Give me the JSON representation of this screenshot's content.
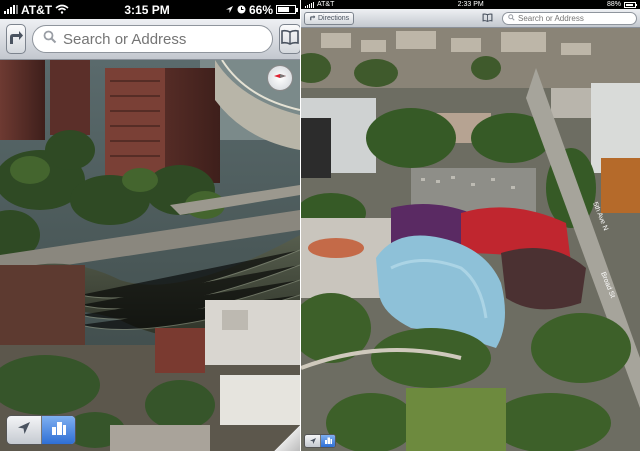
{
  "left": {
    "status": {
      "carrier": "AT&T",
      "time": "3:15 PM",
      "battery": "66%"
    },
    "search": {
      "placeholder": "Search or Address"
    },
    "toolbar": {
      "directions_icon": "directions-arrow-icon",
      "bookmarks_icon": "bookmarks-book-icon"
    },
    "controls": {
      "location_icon": "location-arrow-icon",
      "view_3d_icon": "3d-buildings-icon",
      "compass_icon": "compass-icon"
    }
  },
  "right": {
    "status": {
      "carrier": "AT&T",
      "time": "2:33 PM",
      "battery": "88%"
    },
    "toolbar": {
      "directions_label": "Directions",
      "bookmarks_icon": "bookmarks-book-icon"
    },
    "search": {
      "placeholder": "Search or Address"
    },
    "map": {
      "street_label_1": "5th Ave N",
      "street_label_2": "Broad St"
    },
    "controls": {
      "location_icon": "location-arrow-icon",
      "view_3d_icon": "3d-buildings-icon"
    }
  },
  "colors": {
    "accent_blue": "#2f6fd5",
    "toolbar_top": "#eef0f3",
    "toolbar_bottom": "#c3c8cf"
  }
}
